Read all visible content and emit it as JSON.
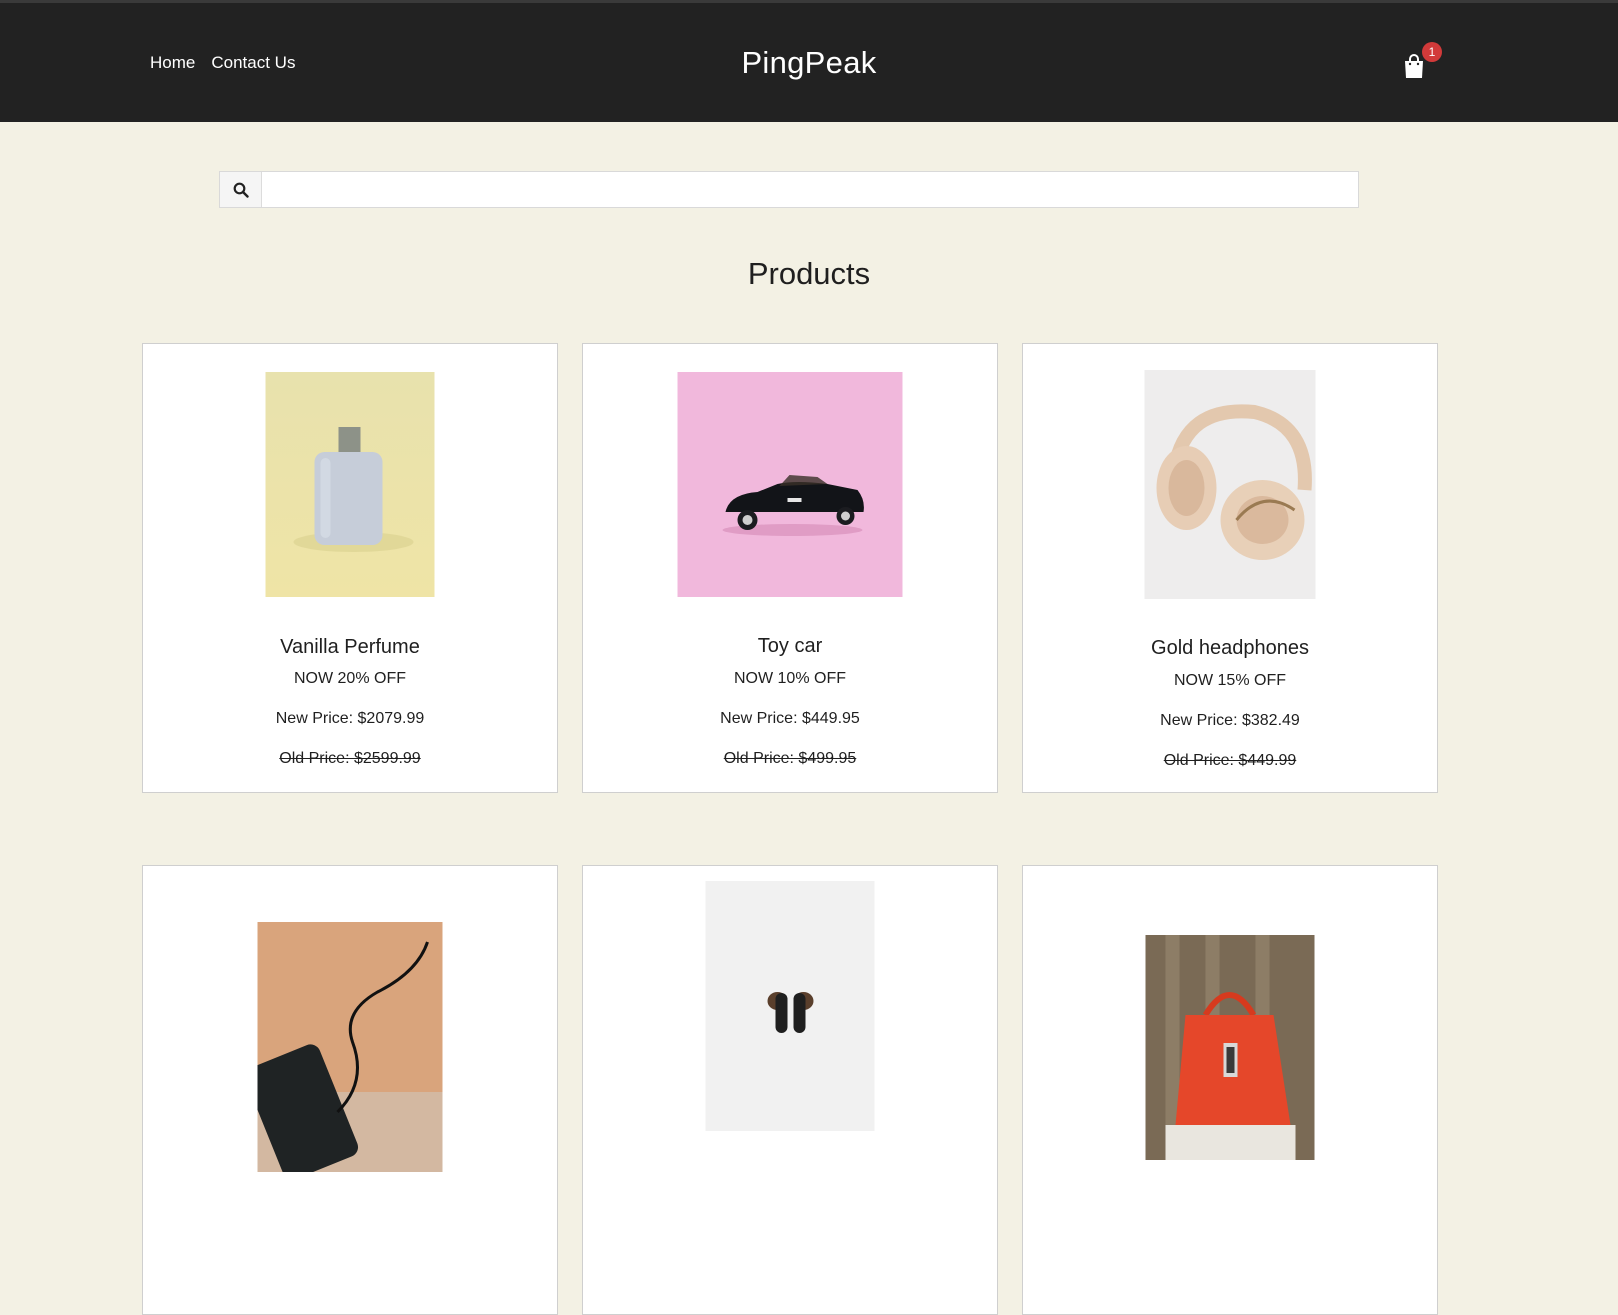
{
  "header": {
    "nav": [
      "Home",
      "Contact Us"
    ],
    "brand": "PingPeak",
    "cart_count": "1"
  },
  "search": {
    "placeholder": ""
  },
  "page_title": "Products",
  "products": [
    {
      "name": "Vanilla Perfume",
      "discount": "NOW 20% OFF",
      "new_price": "New Price: $2079.99",
      "old_price": "Old Price: $2599.99"
    },
    {
      "name": "Toy car",
      "discount": "NOW 10% OFF",
      "new_price": "New Price: $449.95",
      "old_price": "Old Price: $499.95"
    },
    {
      "name": "Gold headphones",
      "discount": "NOW 15% OFF",
      "new_price": "New Price: $382.49",
      "old_price": "Old Price: $449.99"
    }
  ]
}
